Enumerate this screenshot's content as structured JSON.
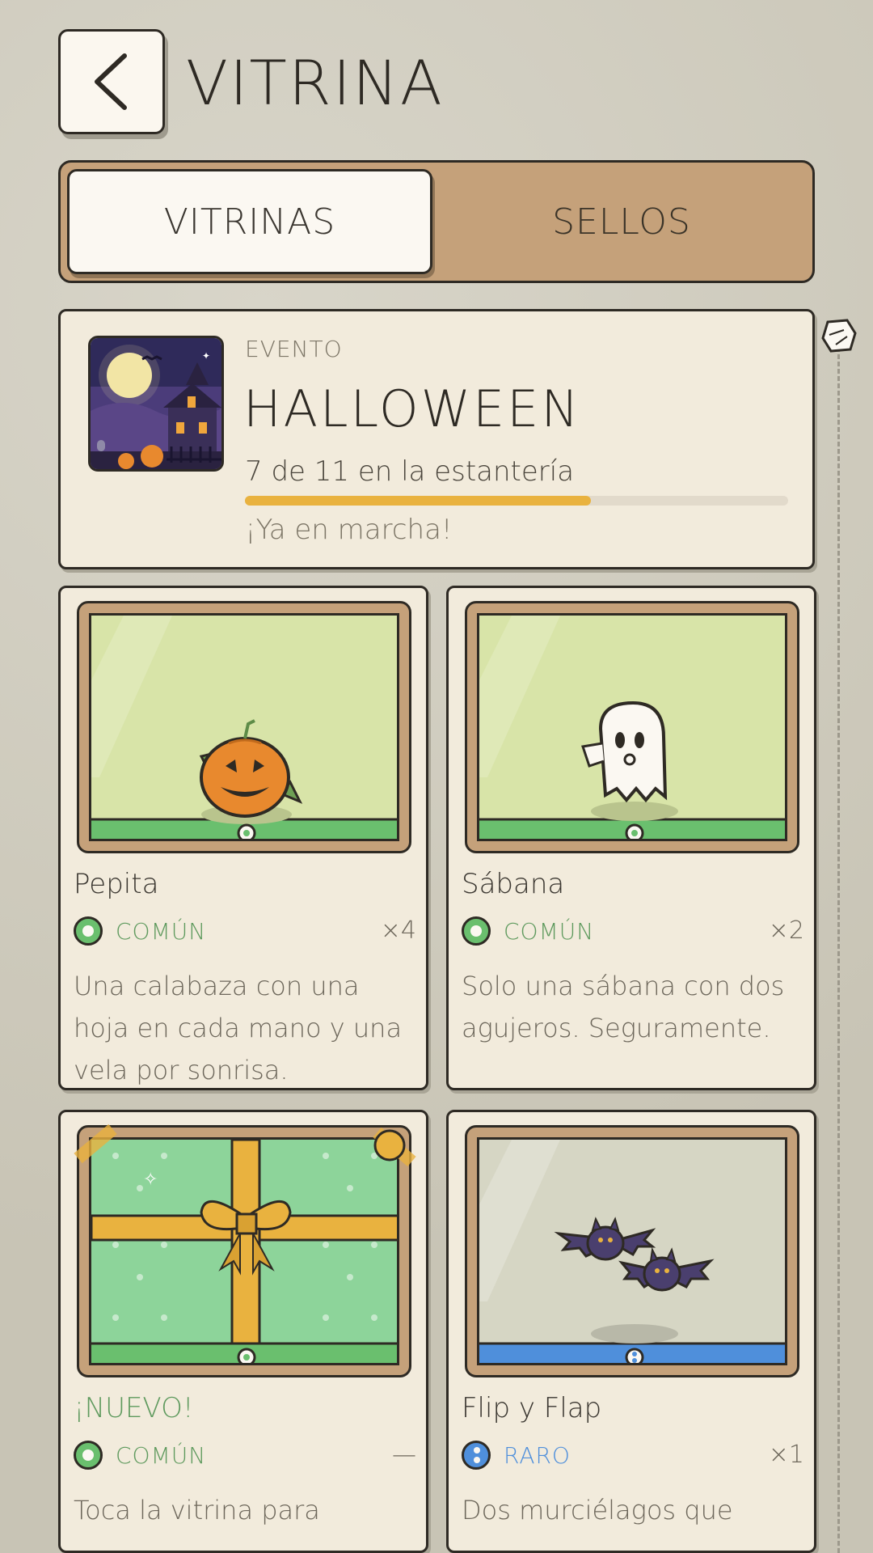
{
  "header": {
    "title": "VITRINA"
  },
  "tabs": [
    {
      "label": "VITRINAS",
      "active": true
    },
    {
      "label": "SELLOS",
      "active": false
    }
  ],
  "event": {
    "category": "EVENTO",
    "name": "HALLOWEEN",
    "progress_text": "7 de 11 en la estantería",
    "collected": 7,
    "total": 11,
    "status": "¡Ya en marcha!"
  },
  "items": [
    {
      "name": "Pepita",
      "rarity": "COMÚN",
      "count": "×4",
      "description": "Una calabaza con una hoja en cada mano y una vela por sonrisa.",
      "display": "pumpkin"
    },
    {
      "name": "Sábana",
      "rarity": "COMÚN",
      "count": "×2",
      "description": "Solo una sábana con dos agujeros. Seguramente.",
      "display": "ghost"
    },
    {
      "name": "¡NUEVO!",
      "rarity": "COMÚN",
      "count": "—",
      "description": "Toca la vitrina para",
      "display": "gift"
    },
    {
      "name": "Flip y Flap",
      "rarity": "RARO",
      "count": "×1",
      "description": "Dos murciélagos que",
      "display": "bats"
    }
  ],
  "colors": {
    "common": "#6abf6e",
    "rare": "#4f8fdb",
    "new": "#5f9a5e",
    "accent": "#e9b23f",
    "tab_bg": "#c5a17a"
  }
}
